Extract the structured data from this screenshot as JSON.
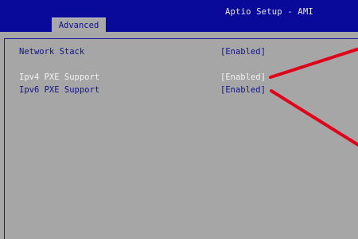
{
  "header": {
    "title": "Aptio Setup - AMI",
    "tab_label": "Advanced"
  },
  "settings": [
    {
      "label": "Network Stack",
      "value": "[Enabled]"
    },
    {
      "label": "Ipv4 PXE Support",
      "value": "[Enabled]"
    },
    {
      "label": "Ipv6 PXE Support",
      "value": "[Enabled]"
    }
  ],
  "colors": {
    "header_bg": "#0a0a9a",
    "body_bg": "#a6a6a6",
    "text_blue": "#13138c",
    "annotation_red": "#e0001a"
  }
}
